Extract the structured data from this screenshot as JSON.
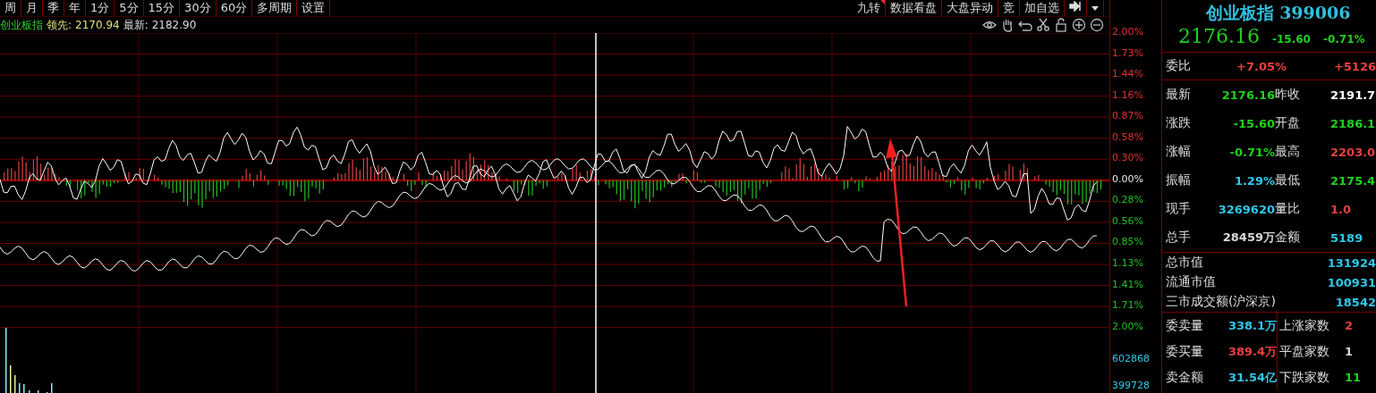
{
  "toolbar": {
    "left": [
      "周",
      "月",
      "季",
      "年",
      "1分",
      "5分",
      "15分",
      "30分",
      "60分",
      "多周期",
      "设置"
    ],
    "right": [
      {
        "label": "九转",
        "marked": true
      },
      {
        "label": "数据看盘",
        "marked": false
      },
      {
        "label": "大盘异动",
        "marked": false
      },
      {
        "label": "竞",
        "marked": false
      },
      {
        "label": "加自选",
        "marked": false
      }
    ]
  },
  "info": {
    "name": "创业板指",
    "lead_label": "领先:",
    "lead": "2170.94",
    "latest_label": "最新:",
    "latest": "2182.90"
  },
  "axis": [
    {
      "text": "2.00%",
      "color": "#e03030"
    },
    {
      "text": "1.73%",
      "color": "#e03030"
    },
    {
      "text": "1.44%",
      "color": "#e03030"
    },
    {
      "text": "1.16%",
      "color": "#e03030"
    },
    {
      "text": "0.87%",
      "color": "#e03030"
    },
    {
      "text": "0.58%",
      "color": "#e03030"
    },
    {
      "text": "0.30%",
      "color": "#e03030"
    },
    {
      "text": "0.00%",
      "color": "#e8e8e8"
    },
    {
      "text": "0.28%",
      "color": "#20c020"
    },
    {
      "text": "0.56%",
      "color": "#20c020"
    },
    {
      "text": "0.85%",
      "color": "#20c020"
    },
    {
      "text": "1.13%",
      "color": "#20c020"
    },
    {
      "text": "1.41%",
      "color": "#20c020"
    },
    {
      "text": "1.71%",
      "color": "#20c020"
    },
    {
      "text": "2.00%",
      "color": "#20c020"
    }
  ],
  "volume_axis": [
    "602868",
    "399728"
  ],
  "quote": {
    "name": "创业板指 399006",
    "price": "2176.16",
    "change": "-15.60",
    "change_pct": "-0.71%",
    "ratio": {
      "label": "委比",
      "value": "+7.05%",
      "value2": "+5126"
    },
    "rows": [
      {
        "cells": [
          {
            "label": "最新",
            "value": "2176.16",
            "color": "#20d020"
          },
          {
            "label": "昨收",
            "value": "2191.7",
            "color": "#ffffff"
          }
        ]
      },
      {
        "cells": [
          {
            "label": "涨跌",
            "value": "-15.60",
            "color": "#20d020"
          },
          {
            "label": "开盘",
            "value": "2186.1",
            "color": "#20d020"
          }
        ]
      },
      {
        "cells": [
          {
            "label": "涨幅",
            "value": "-0.71%",
            "color": "#20d020"
          },
          {
            "label": "最高",
            "value": "2203.0",
            "color": "#e84040"
          }
        ]
      },
      {
        "cells": [
          {
            "label": "振幅",
            "value": "1.29%",
            "color": "#30c8e8"
          },
          {
            "label": "最低",
            "value": "2175.4",
            "color": "#20d020"
          }
        ]
      }
    ],
    "volume_rows": [
      {
        "cells": [
          {
            "label": "现手",
            "value": "3269620",
            "color": "#30c8e8"
          },
          {
            "label": "量比",
            "value": "1.0",
            "color": "#e84040"
          }
        ]
      },
      {
        "cells": [
          {
            "label": "总手",
            "value": "28459万",
            "color": "#d8d8d8"
          },
          {
            "label": "金额",
            "value": "5189",
            "color": "#30c8e8"
          }
        ]
      }
    ],
    "market_rows": [
      {
        "label": "总市值",
        "value": "131924"
      },
      {
        "label": "流通市值",
        "value": "100931"
      },
      {
        "label": "三市成交额(沪深京)",
        "value": "18542"
      }
    ],
    "bottom_rows": [
      {
        "cells": [
          {
            "label": "委卖量",
            "value": "338.1万",
            "color": "#30c8e8"
          },
          {
            "label": "上涨家数",
            "value": "2",
            "color": "#e84040"
          }
        ]
      },
      {
        "cells": [
          {
            "label": "委买量",
            "value": "389.4万",
            "color": "#e84040"
          },
          {
            "label": "平盘家数",
            "value": "1",
            "color": "#d8d8d8"
          }
        ]
      },
      {
        "cells": [
          {
            "label": "卖金额",
            "value": "31.54亿",
            "color": "#30c8e8"
          },
          {
            "label": "下跌家数",
            "value": "11",
            "color": "#20d020"
          }
        ]
      }
    ]
  }
}
